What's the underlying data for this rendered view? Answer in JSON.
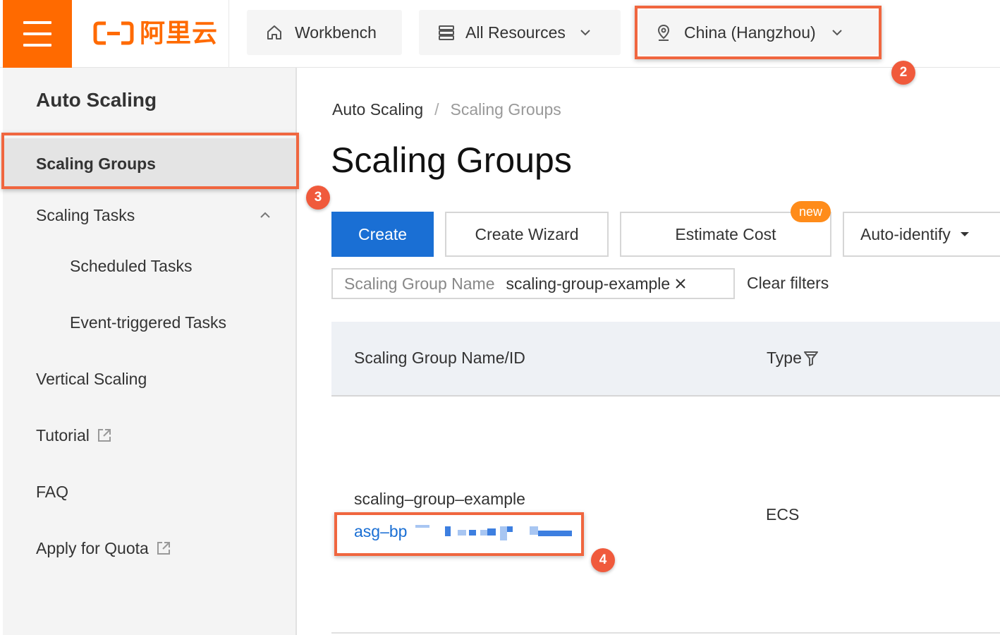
{
  "topbar": {
    "logo_text": "阿里云",
    "workbench_label": "Workbench",
    "all_resources_label": "All Resources",
    "region_label": "China (Hangzhou)"
  },
  "sidebar": {
    "title": "Auto Scaling",
    "items": [
      {
        "label": "Scaling Groups"
      },
      {
        "label": "Scaling Tasks"
      },
      {
        "label": "Scheduled Tasks"
      },
      {
        "label": "Event-triggered Tasks"
      },
      {
        "label": "Vertical Scaling"
      },
      {
        "label": "Tutorial"
      },
      {
        "label": "FAQ"
      },
      {
        "label": "Apply for Quota"
      }
    ]
  },
  "breadcrumb": {
    "root": "Auto Scaling",
    "separator": "/",
    "current": "Scaling Groups"
  },
  "page": {
    "title": "Scaling Groups"
  },
  "toolbar": {
    "create_label": "Create",
    "wizard_label": "Create Wizard",
    "estimate_label": "Estimate Cost",
    "new_badge": "new",
    "auto_identify_label": "Auto-identify"
  },
  "filter": {
    "key": "Scaling Group Name",
    "value": "scaling-group-example",
    "clear_label": "Clear filters"
  },
  "table": {
    "columns": [
      "Scaling Group Name/ID",
      "Type"
    ],
    "rows": [
      {
        "name": "scaling–group–example",
        "id_prefix": "asg–bp",
        "type": "ECS"
      }
    ]
  },
  "annotations": {
    "steps": [
      "2",
      "3",
      "4"
    ]
  },
  "colors": {
    "brand": "#ff6a00",
    "primary": "#1a6fd4",
    "highlight": "#f0663f",
    "badge": "#ff8c1a"
  }
}
